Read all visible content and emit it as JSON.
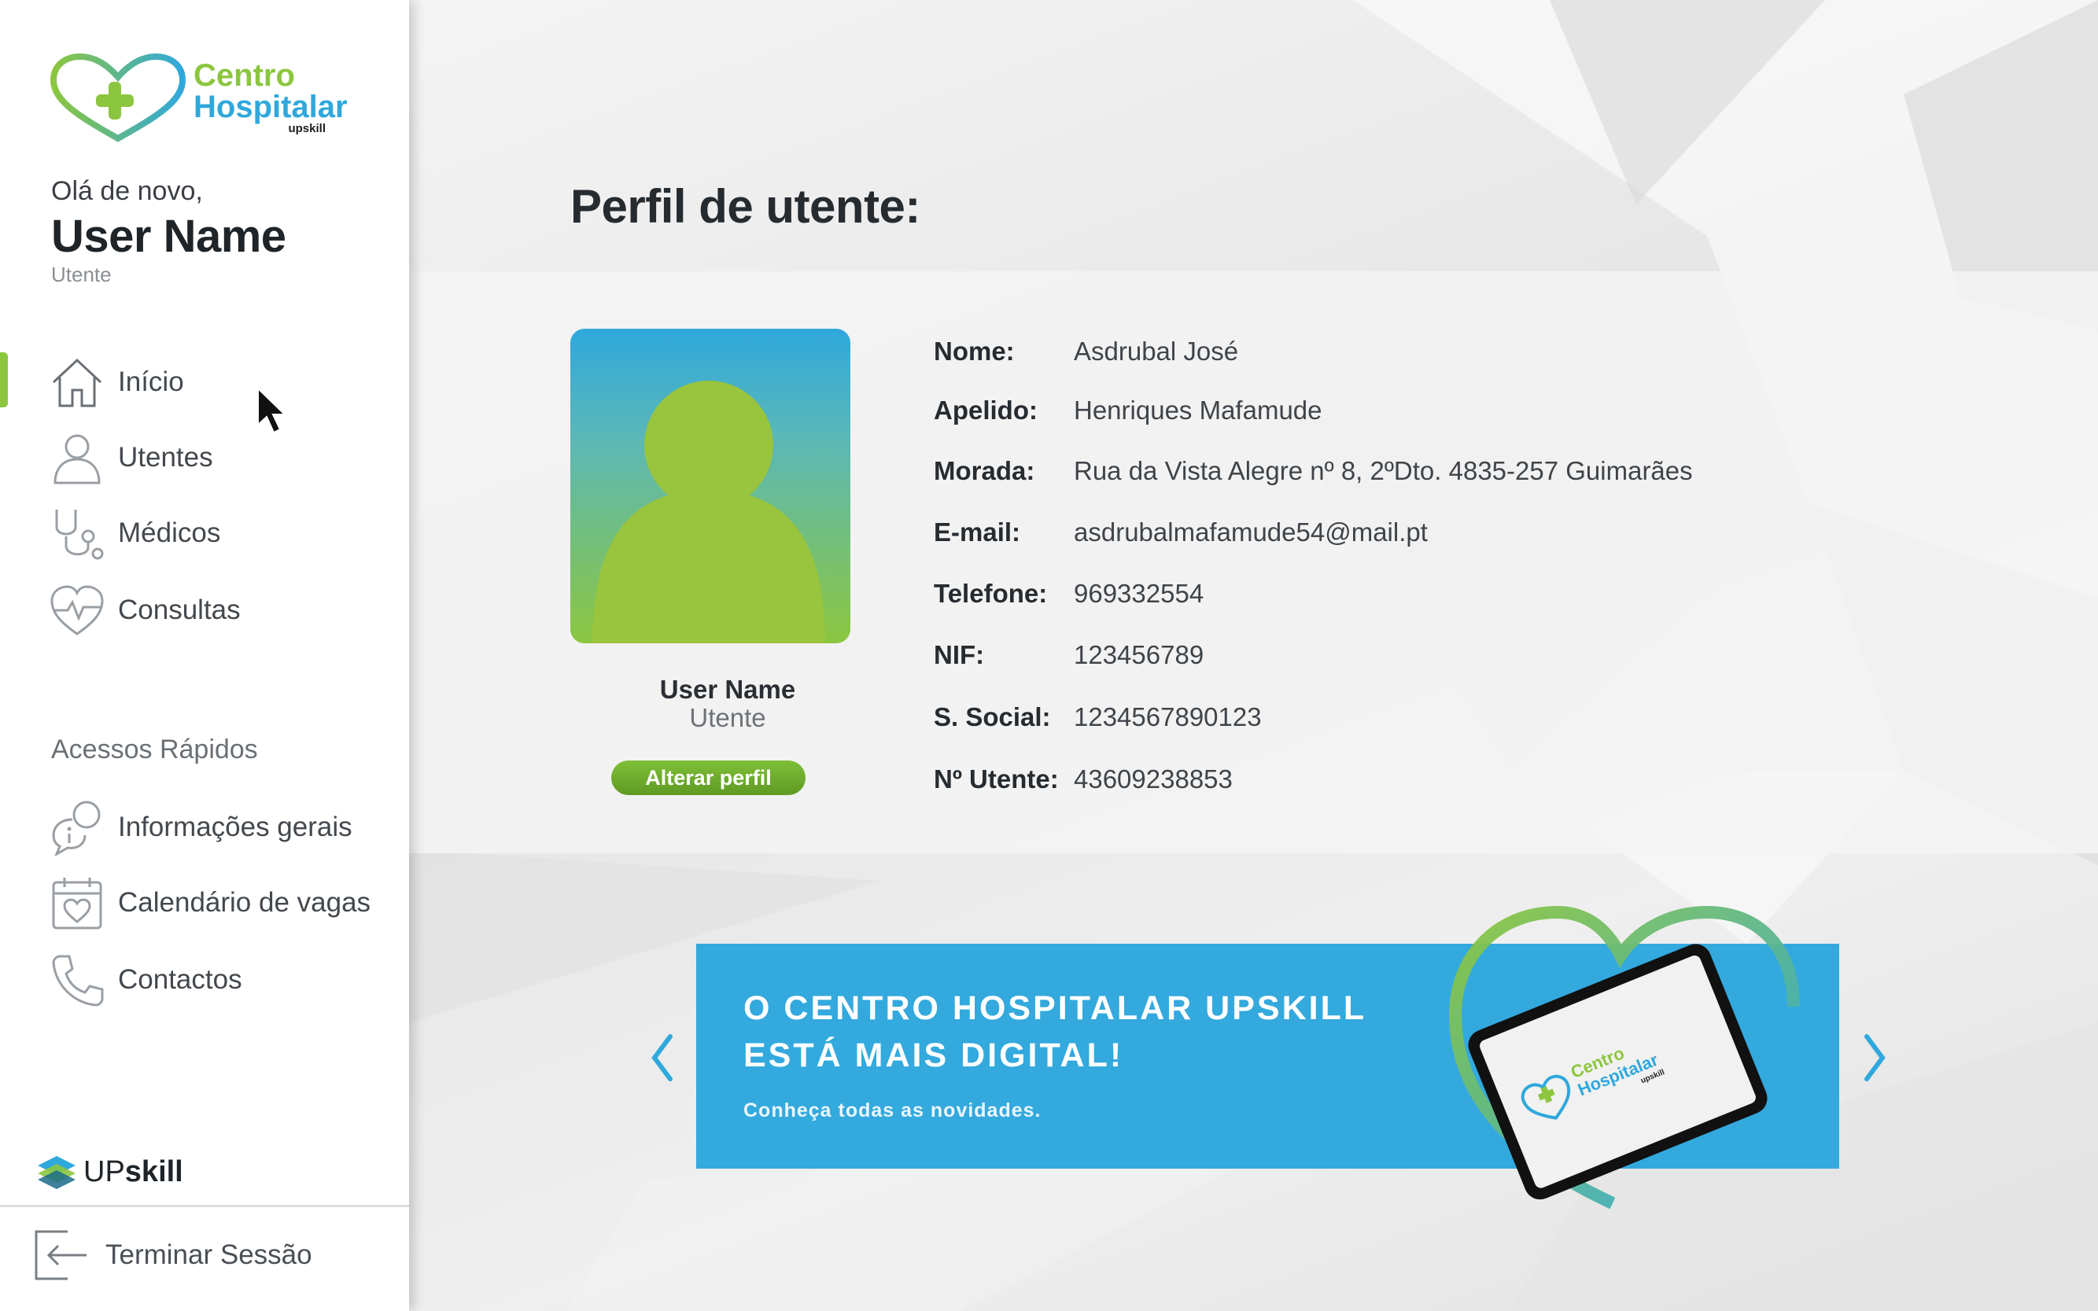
{
  "brand": {
    "logo_line1": "Centro",
    "logo_line2": "Hospitalar",
    "logo_line3": "upskill",
    "colors": {
      "green": "#8cc63f",
      "blue": "#2fa8dc",
      "banner": "#33a9de"
    }
  },
  "sidebar": {
    "greeting": "Olá de novo,",
    "user_name": "User Name",
    "user_role": "Utente",
    "nav": [
      {
        "label": "Início",
        "icon": "home-icon",
        "active": true
      },
      {
        "label": "Utentes",
        "icon": "user-icon"
      },
      {
        "label": "Médicos",
        "icon": "stethoscope-icon"
      },
      {
        "label": "Consultas",
        "icon": "heart-pulse-icon"
      }
    ],
    "quick_access_title": "Acessos Rápidos",
    "quick_access": [
      {
        "label": "Informações gerais",
        "icon": "info-chat-icon"
      },
      {
        "label": "Calendário de vagas",
        "icon": "calendar-heart-icon"
      },
      {
        "label": "Contactos",
        "icon": "phone-icon"
      }
    ],
    "footer_logo": {
      "up": "UP",
      "skill": "skill"
    },
    "logout_label": "Terminar Sessão"
  },
  "main": {
    "title": "Perfil de utente:",
    "profile": {
      "name": "User Name",
      "role": "Utente",
      "edit_button": "Alterar perfil",
      "fields": [
        {
          "key": "Nome:",
          "value": "Asdrubal José"
        },
        {
          "key": "Apelido:",
          "value": "Henriques Mafamude"
        },
        {
          "key": "Morada:",
          "value": "Rua da Vista Alegre nº 8, 2ºDto. 4835-257 Guimarães"
        },
        {
          "key": "E-mail:",
          "value": "asdrubalmafamude54@mail.pt"
        },
        {
          "key": "Telefone:",
          "value": "969332554"
        },
        {
          "key": "NIF:",
          "value": "123456789"
        },
        {
          "key": "S. Social:",
          "value": "1234567890123"
        },
        {
          "key": "Nº Utente:",
          "value": "43609238853"
        }
      ]
    },
    "banner": {
      "headline_1": "O CENTRO HOSPITALAR UPSKILL",
      "headline_2": "ESTÁ MAIS DIGITAL!",
      "subtitle": "Conheça todas as novidades.",
      "tablet_logo_1": "Centro",
      "tablet_logo_2": "Hospitalar",
      "tablet_logo_3": "upskill"
    }
  }
}
